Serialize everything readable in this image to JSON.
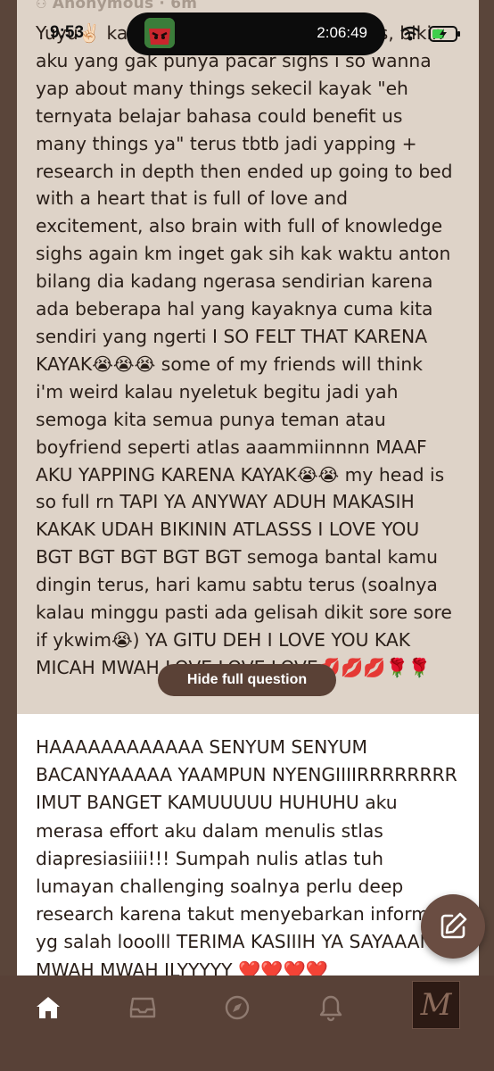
{
  "status_bar": {
    "time": "9:53",
    "timer": "2:06:49",
    "icons": [
      "wifi-icon",
      "battery-charging-icon"
    ]
  },
  "question": {
    "author": "Anonymous · 6m",
    "text": "Yuyu✌🏻 kak makasih banyak buat atlas, bikin aku yang gak punya pacar sighs i so wanna yap about many things sekecil kayak \"eh ternyata belajar bahasa could benefit us many things ya\" terus tbtb jadi yapping + research in depth then ended up going to bed with a heart that is full of love and excitement, also brain with full of knowledge sighs again km inget gak sih kak waktu anton bilang dia kadang ngerasa sendirian karena ada beberapa hal yang kayaknya cuma kita sendiri yang ngerti I SO FELT THAT KARENA KAYAK😭😭😭 some of my friends will think i'm weird kalau nyeletuk begitu jadi yah semoga kita semua punya teman atau boyfriend seperti atlas aaammiinnnn MAAF AKU YAPPING KARENA KAYAK😭😭 my head is so full rn TAPI YA ANYWAY ADUH MAKASIH KAKAK UDAH BIKININ ATLASSS I LOVE YOU BGT BGT BGT BGT BGT semoga bantal kamu dingin terus, hari kamu sabtu terus (soalnya kalau minggu pasti ada gelisah dikit sore sore if ykwim😭) YA GITU DEH I LOVE YOU KAK MICAH MWAH LOVE LOVE LOVE💋💋💋🌹🌹",
    "hide_button": "Hide full question"
  },
  "answer": {
    "text": "HAAAAAAAAAAAA SENYUM SENYUM BACANYAAAAA YAAMPUN NYENGIIIIRRRRRRRR IMUT BANGET KAMUUUUU HUHUHU aku merasa effort aku dalam menulis stlas diapresiasiiii!!! Sumpah nulis atlas tuh lumayan challenging soalnya perlu deep research karena takut menyebarkan informasi yg salah looolll TERIMA KASIIIH YA SAYAAANG MWAH MWAH ILYYYYY ❤️❤️❤️❤️"
  },
  "fab": {
    "icon": "edit-icon"
  },
  "bottom_nav": {
    "items": [
      "home-icon",
      "inbox-icon",
      "explore-icon",
      "notifications-icon",
      "profile-avatar"
    ],
    "avatar_monogram": "M"
  },
  "colors": {
    "question_bg": "#ded3c8",
    "answer_bg": "#ffffff",
    "accent": "#5a4136",
    "nav_bg": "#584137"
  }
}
